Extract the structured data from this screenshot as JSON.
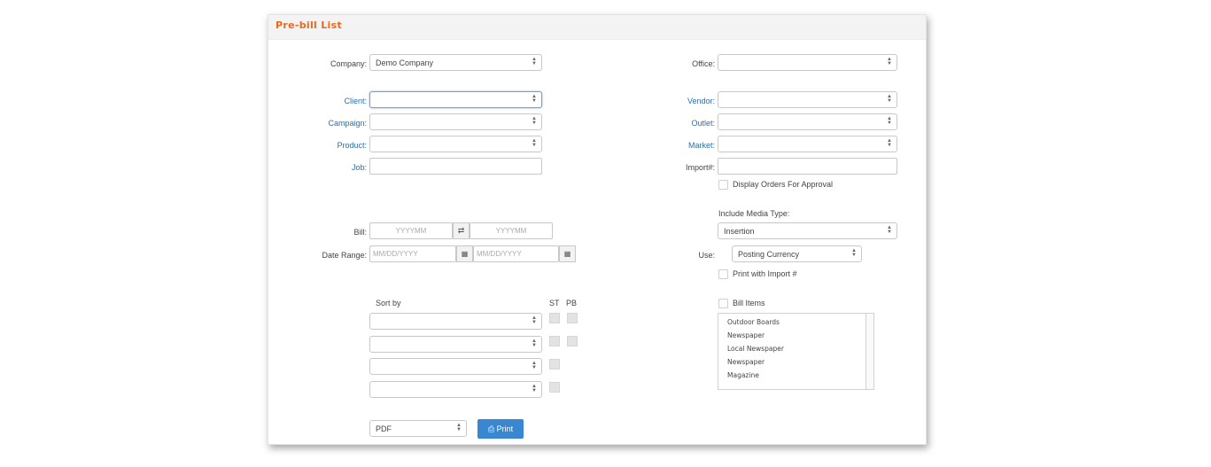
{
  "panel": {
    "title": "Pre-bill List"
  },
  "filters_left": {
    "company": {
      "label": "Company:",
      "value": "Demo Company"
    },
    "client": {
      "label": "Client:",
      "value": ""
    },
    "campaign": {
      "label": "Campaign:",
      "value": ""
    },
    "product": {
      "label": "Product:",
      "value": ""
    },
    "job": {
      "label": "Job:",
      "value": ""
    }
  },
  "filters_right": {
    "office": {
      "label": "Office:",
      "value": ""
    },
    "vendor": {
      "label": "Vendor:",
      "value": ""
    },
    "outlet": {
      "label": "Outlet:",
      "value": ""
    },
    "market": {
      "label": "Market:",
      "value": ""
    },
    "import": {
      "label": "Import#:",
      "value": ""
    },
    "display_orders_label": "Display Orders For Approval"
  },
  "bill": {
    "label": "Bill:",
    "from_placeholder": "YYYYMM",
    "to_placeholder": "YYYYMM",
    "swap_icon": "swap-icon"
  },
  "date_range": {
    "label": "Date Range:",
    "from_placeholder": "MM/DD/YYYY",
    "to_placeholder": "MM/DD/YYYY",
    "calendar_icon": "calendar-icon"
  },
  "media": {
    "label": "Include Media Type:",
    "value": "Insertion"
  },
  "use": {
    "label": "Use:",
    "value": "Posting Currency"
  },
  "print_with_import_label": "Print with Import #",
  "sort": {
    "label": "Sort by",
    "st_label": "ST",
    "pb_label": "PB",
    "rows": [
      "",
      "",
      "",
      ""
    ]
  },
  "bill_items": {
    "label": "Bill Items",
    "items": [
      "Outdoor Boards",
      "Newspaper",
      "Local Newspaper",
      "Newspaper",
      "Magazine"
    ]
  },
  "output": {
    "format": "PDF",
    "print_label": "Print",
    "print_icon": "printer-icon"
  },
  "colors": {
    "accent": "#e96a1c",
    "link": "#2a6fb0",
    "button": "#3a87d1"
  }
}
